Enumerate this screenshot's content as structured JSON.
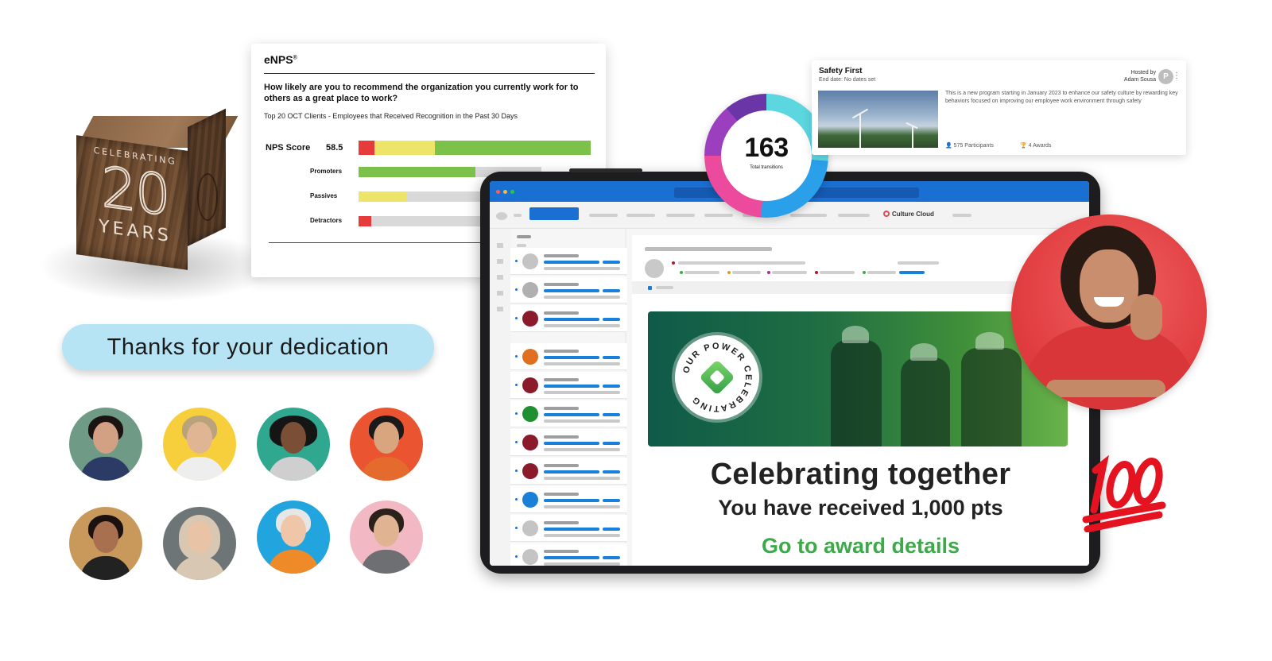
{
  "cube": {
    "line1": "CELEBRATING",
    "number": "20",
    "line2": "YEARS"
  },
  "enps": {
    "title": "eNPS",
    "title_mark": "®",
    "question": "How likely are you to recommend the organization you currently work for to others as a great place to work?",
    "subtitle": "Top 20 OCT Clients - Employees that Received Recognition in the Past 30 Days",
    "score_label": "NPS Score",
    "score_value": "58.5",
    "score_bar": {
      "detractors": 0.07,
      "passives": 0.26,
      "promoters": 0.67
    },
    "categories": [
      {
        "label": "Promoters",
        "fraction": 0.64,
        "color": "#7cc14a"
      },
      {
        "label": "Passives",
        "fraction": 0.26,
        "color": "#ede46a"
      },
      {
        "label": "Detractors",
        "fraction": 0.07,
        "color": "#e53b3b"
      }
    ]
  },
  "thanks_text": "Thanks for your dedication",
  "donut": {
    "value": "163",
    "label": "Total transitions"
  },
  "safety": {
    "title": "Safety First",
    "end_date": "End date: No dates set",
    "hosted_by_label": "Hosted by",
    "host_name": "Adam Sousa",
    "host_initial": "P",
    "description": "This is a new program starting in January 2023 to enhance our safety culture by rewarding key behaviors focused on improving our employee work environment through safety",
    "participants": "575 Participants",
    "awards": "4 Awards"
  },
  "app": {
    "brand": "Culture Cloud",
    "badge_text": "OUR POWER CELEBRATING",
    "headline": "Celebrating together",
    "points_text": "You have received 1,000 pts",
    "cta": "Go to award details"
  },
  "colors": {
    "outlook_blue": "#1a6fd3",
    "cta_green": "#3daa49",
    "pill_blue": "#b6e4f5"
  },
  "icons": {
    "people": "people-icon",
    "trophy": "trophy-icon",
    "kebab": "kebab-icon",
    "hundred": "hundred-points-emoji"
  }
}
